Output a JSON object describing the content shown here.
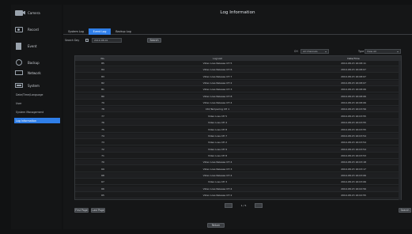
{
  "sidebar": {
    "items": [
      {
        "label": "Camera",
        "icon": "camera-icon"
      },
      {
        "label": "Record",
        "icon": "record-icon"
      },
      {
        "label": "Event",
        "icon": "event-icon"
      },
      {
        "label": "Backup",
        "icon": "backup-icon"
      },
      {
        "label": "Network",
        "icon": "network-icon"
      },
      {
        "label": "System",
        "icon": "system-icon"
      }
    ],
    "subitems": [
      {
        "label": "Date/Time/Language",
        "active": false
      },
      {
        "label": "User",
        "active": false
      },
      {
        "label": "System Management",
        "active": false
      },
      {
        "label": "Log Information",
        "active": true
      }
    ]
  },
  "main": {
    "title": "Log Information",
    "tabs": [
      {
        "label": "System Log",
        "active": false
      },
      {
        "label": "Event Log",
        "active": true
      },
      {
        "label": "Backup Log",
        "active": false
      }
    ],
    "search": {
      "label": "Search Day",
      "date_value": "2019-08-01",
      "button": "Search"
    },
    "filters": {
      "ch_label": "CH",
      "ch_value": "All Channels",
      "type_label": "Type",
      "type_value": "View All"
    },
    "table": {
      "headers": [
        "No.",
        "Log List",
        "Date/Time"
      ],
      "rows": [
        [
          "85",
          "Video Loss Release CH 5",
          "2019-08-15 16:08:11"
        ],
        [
          "84",
          "Video Loss Release CH 6",
          "2019-08-15 16:08:07"
        ],
        [
          "83",
          "Video Loss Release CH 7",
          "2019-08-15 16:08:07"
        ],
        [
          "82",
          "Video Loss Release CH 2",
          "2019-08-15 16:08:07"
        ],
        [
          "81",
          "Video Loss Release CH 3",
          "2019-08-15 16:08:06"
        ],
        [
          "80",
          "Video Loss Release CH 8",
          "2019-08-15 16:08:06"
        ],
        [
          "79",
          "Video Loss Release CH 4",
          "2019-08-15 16:08:06"
        ],
        [
          "78",
          "Ctrl/Tampering CH 1",
          "2019-08-15 16:03:56"
        ],
        [
          "77",
          "Video Loss CH 5",
          "2019-08-15 16:03:55"
        ],
        [
          "76",
          "Video Loss CH 4",
          "2019-08-15 16:03:55"
        ],
        [
          "75",
          "Video Loss CH 8",
          "2019-08-15 16:03:55"
        ],
        [
          "74",
          "Video Loss CH 7",
          "2019-08-15 16:03:54"
        ],
        [
          "73",
          "Video Loss CH 2",
          "2019-08-15 16:03:54"
        ],
        [
          "72",
          "Video Loss CH 9",
          "2019-08-15 16:03:54"
        ],
        [
          "71",
          "Video Loss CH 8",
          "2019-08-15 16:03:53"
        ],
        [
          "70",
          "Video Loss Release CH 4",
          "2019-08-15 16:03:18"
        ],
        [
          "69",
          "Video Loss Release CH 3",
          "2019-08-15 16:03:17"
        ],
        [
          "68",
          "Video Loss Release CH 4",
          "2019-08-15 16:03:06"
        ],
        [
          "67",
          "Video Loss CH 3",
          "2019-08-15 16:03:06"
        ],
        [
          "66",
          "Video Loss Release CH 4",
          "2019-08-15 16:02:56"
        ],
        [
          "65",
          "Video Loss Release CH 2",
          "2019-08-15 16:02:55"
        ]
      ]
    },
    "pager": {
      "page_text": "1 / 5"
    },
    "buttons": {
      "first_page": "First Page",
      "last_page": "Last Page",
      "search_bottom": "Search",
      "return": "Return"
    }
  }
}
